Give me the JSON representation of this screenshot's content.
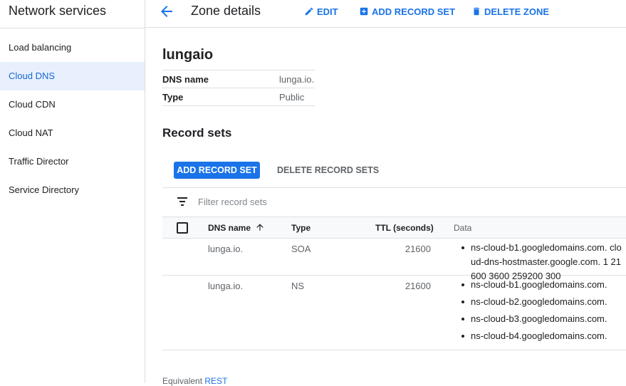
{
  "sidebar": {
    "title": "Network services",
    "items": [
      {
        "label": "Load balancing"
      },
      {
        "label": "Cloud DNS"
      },
      {
        "label": "Cloud CDN"
      },
      {
        "label": "Cloud NAT"
      },
      {
        "label": "Traffic Director"
      },
      {
        "label": "Service Directory"
      }
    ],
    "active_index": 1
  },
  "topbar": {
    "title": "Zone details",
    "edit_label": "EDIT",
    "add_record_label": "ADD RECORD SET",
    "delete_zone_label": "DELETE ZONE"
  },
  "zone": {
    "name": "lungaio",
    "dns_name_key": "DNS name",
    "dns_name_value": "lunga.io.",
    "type_key": "Type",
    "type_value": "Public"
  },
  "record_sets": {
    "title": "Record sets",
    "add_label": "ADD RECORD SET",
    "delete_label": "DELETE RECORD SETS",
    "filter_placeholder": "Filter record sets",
    "columns": {
      "dns_name": "DNS name",
      "type": "Type",
      "ttl": "TTL (seconds)",
      "data": "Data"
    },
    "rows": [
      {
        "dns_name": "lunga.io.",
        "type": "SOA",
        "ttl": "21600",
        "data": [
          "ns-cloud-b1.googledomains.com. cloud-dns-hostmaster.google.com. 1 21600 3600 259200 300"
        ]
      },
      {
        "dns_name": "lunga.io.",
        "type": "NS",
        "ttl": "21600",
        "data": [
          "ns-cloud-b1.googledomains.com.",
          "ns-cloud-b2.googledomains.com.",
          "ns-cloud-b3.googledomains.com.",
          "ns-cloud-b4.googledomains.com."
        ]
      }
    ]
  },
  "footer": {
    "prefix": "Equivalent",
    "link": "REST"
  },
  "colors": {
    "accent": "#1a73e8",
    "active_bg": "#e8f0fe",
    "divider": "#dadce0"
  }
}
